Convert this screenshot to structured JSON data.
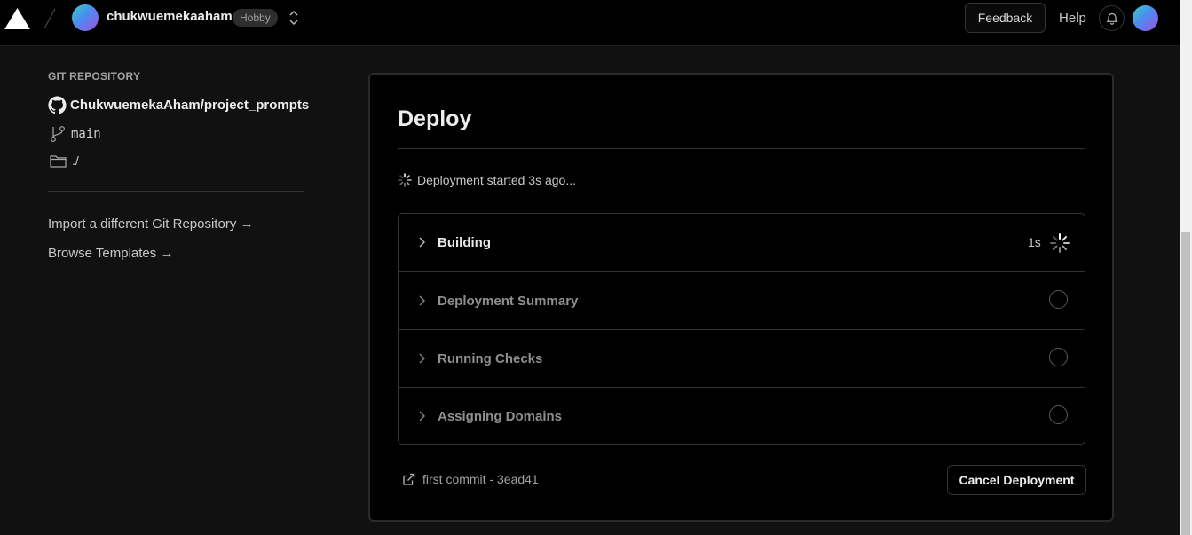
{
  "header": {
    "team_name": "chukwuemekaaham",
    "plan_badge": "Hobby",
    "feedback_label": "Feedback",
    "help_label": "Help",
    "icons": [
      "vercel-logo-icon",
      "slash-separator-icon",
      "team-switcher-icon",
      "bell-icon"
    ]
  },
  "sidebar": {
    "section_label": "GIT REPOSITORY",
    "repo": "ChukwuemekaAham/project_prompts",
    "branch": "main",
    "directory": "./",
    "import_link": "Import a different Git Repository →",
    "browse_link": "Browse Templates →"
  },
  "deploy": {
    "title": "Deploy",
    "status": "Deployment started 3s ago...",
    "steps": [
      {
        "label": "Building",
        "state": "in-progress",
        "duration": "1s"
      },
      {
        "label": "Deployment Summary",
        "state": "pending"
      },
      {
        "label": "Running Checks",
        "state": "pending"
      },
      {
        "label": "Assigning Domains",
        "state": "pending"
      }
    ],
    "commit": "first commit - 3ead41",
    "cancel_label": "Cancel Deployment"
  },
  "colors": {
    "background": "#111111",
    "card": "#000000",
    "border": "#333333",
    "text": "#ededed",
    "muted": "#8f8f8f"
  }
}
